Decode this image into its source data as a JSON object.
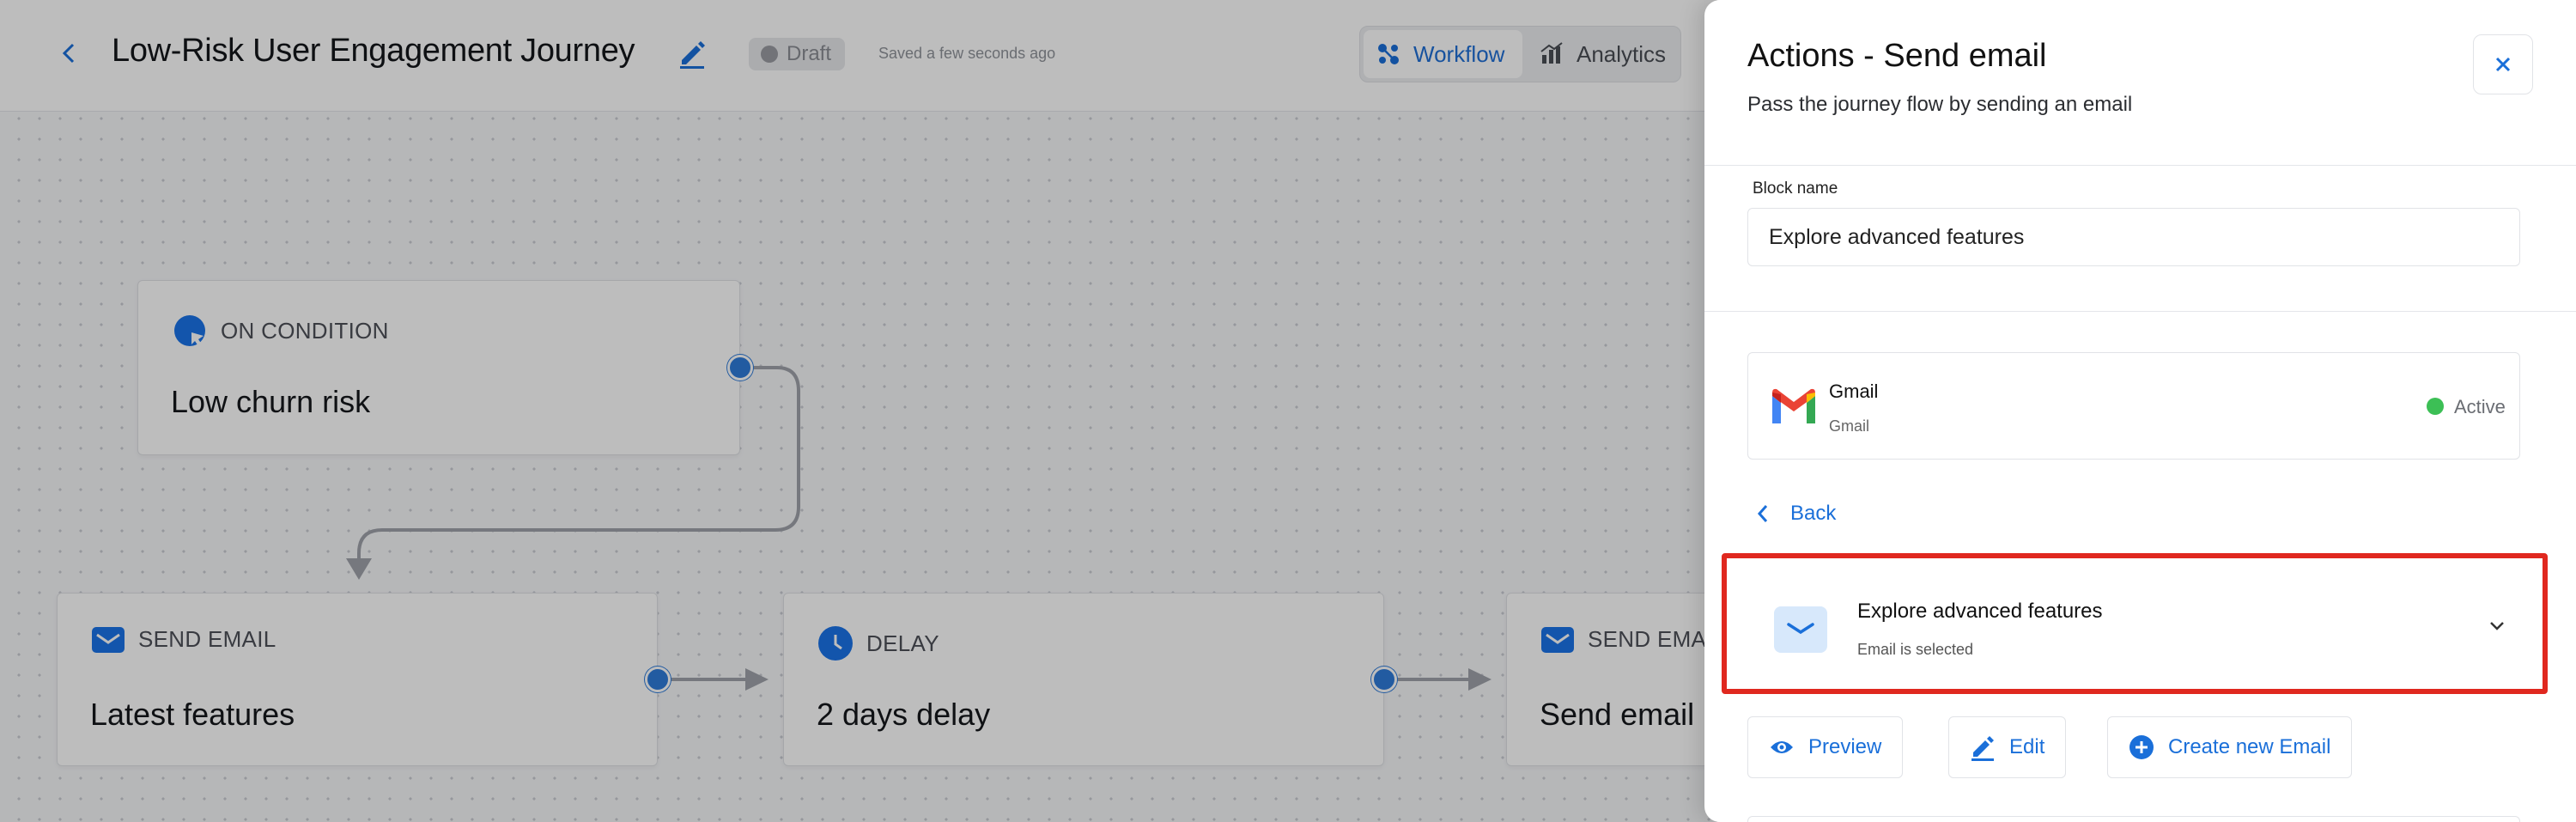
{
  "header": {
    "journey_title": "Low-Risk User Engagement Journey",
    "status_badge": "Draft",
    "saved_text": "Saved a few seconds ago",
    "tabs": [
      {
        "label": "Workflow",
        "active": true
      },
      {
        "label": "Analytics",
        "active": false
      }
    ]
  },
  "workflow": {
    "nodes": [
      {
        "type": "ON CONDITION",
        "name": "Low churn risk",
        "icon": "condition-icon"
      },
      {
        "type": "SEND EMAIL",
        "name": "Latest features",
        "icon": "email-icon"
      },
      {
        "type": "DELAY",
        "name": "2 days delay",
        "icon": "clock-icon"
      },
      {
        "type": "SEND EMA",
        "name": "Send email",
        "icon": "email-icon"
      }
    ]
  },
  "drawer": {
    "title": "Actions - Send email",
    "subtitle": "Pass the journey flow by sending an email",
    "block_name_label": "Block name",
    "block_name_value": "Explore advanced features",
    "provider": {
      "name": "Gmail",
      "sub": "Gmail",
      "status": "Active"
    },
    "back_label": "Back",
    "selected_email": {
      "title": "Explore advanced features",
      "status": "Email is selected"
    },
    "actions": {
      "preview": "Preview",
      "edit": "Edit",
      "create": "Create new Email"
    }
  },
  "colors": {
    "accent": "#1a6fd9",
    "highlight": "#e0281f",
    "active": "#3cbf55"
  }
}
